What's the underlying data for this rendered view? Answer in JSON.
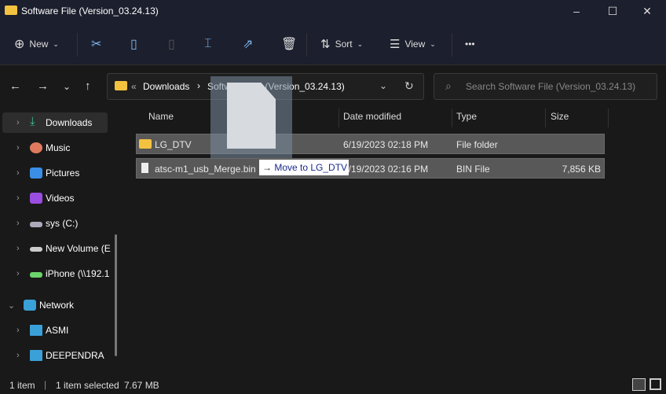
{
  "window": {
    "title": "Software File (Version_03.24.13)",
    "minimize": "–",
    "maximize": "☐",
    "close": "✕"
  },
  "toolbar": {
    "new_label": "New",
    "sort_label": "Sort",
    "view_label": "View",
    "more": "•••"
  },
  "address": {
    "sep": "«",
    "crumbs": [
      "Downloads",
      "Software File (Version_03.24.13)"
    ],
    "arrow": "›"
  },
  "search": {
    "placeholder": "Search Software File (Version_03.24.13)"
  },
  "sidebar": {
    "items": [
      {
        "label": "Downloads",
        "color": "#3fbf8f"
      },
      {
        "label": "Music",
        "color": "#e07a5f"
      },
      {
        "label": "Pictures",
        "color": "#3a8ee6"
      },
      {
        "label": "Videos",
        "color": "#9b4de0"
      },
      {
        "label": "sys (C:)",
        "color": "#aab"
      },
      {
        "label": "New Volume (E",
        "color": "#ccc"
      },
      {
        "label": "iPhone (\\\\192.1",
        "color": "#6ad36a"
      },
      {
        "label": "Network",
        "color": "#3aa0d8"
      },
      {
        "label": "ASMI",
        "color": "#3aa0d8"
      },
      {
        "label": "DEEPENDRA",
        "color": "#3aa0d8"
      }
    ]
  },
  "columns": [
    "Name",
    "Date modified",
    "Type",
    "Size"
  ],
  "files": [
    {
      "name": "LG_DTV",
      "date": "6/19/2023 02:18 PM",
      "type": "File folder",
      "size": ""
    },
    {
      "name": "atsc-m1_usb_Merge.bin",
      "date": "6/19/2023 02:16 PM",
      "type": "BIN File",
      "size": "7,856 KB"
    }
  ],
  "drag_tooltip": {
    "arrow": "→",
    "text": "Move to LG_DTV"
  },
  "status": {
    "count": "1 item",
    "selected": "1 item selected",
    "size": "7.67 MB"
  }
}
